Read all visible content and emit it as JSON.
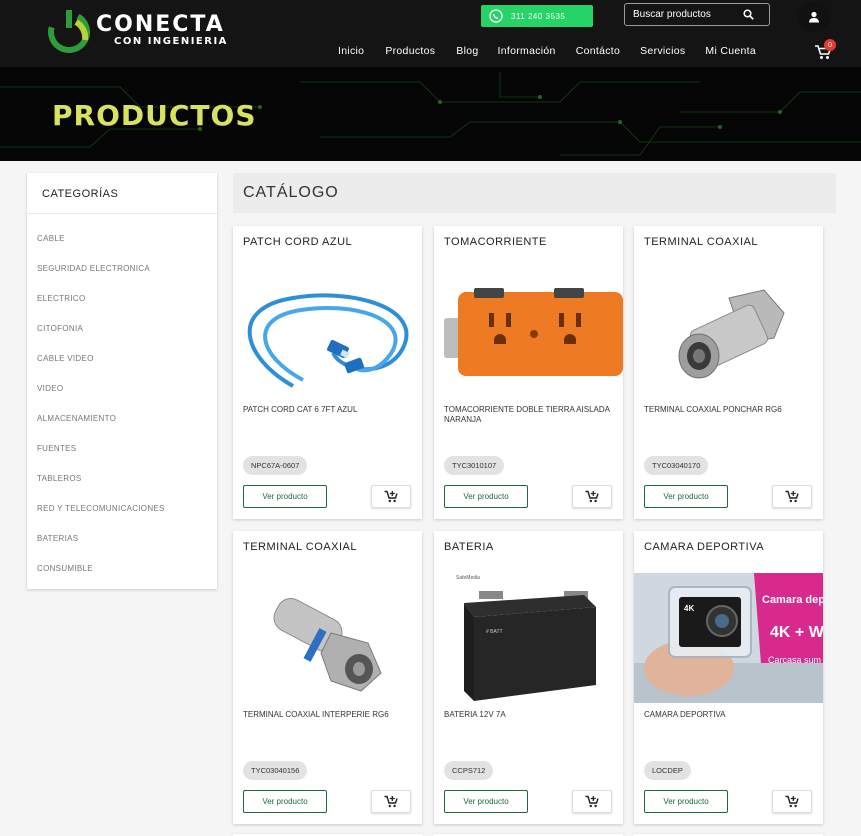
{
  "brand": {
    "logo_word": "CONECTA",
    "logo_sub": "CON INGENIERIA",
    "accent": "#d9e25e",
    "whatsapp_green": "#25d366",
    "button_green": "#1e6b3a"
  },
  "header": {
    "whatsapp_label": "311 240 3535",
    "search_placeholder": "Buscar productos",
    "nav": [
      "Inicio",
      "Productos",
      "Blog",
      "Información",
      "Contácto",
      "Servicios",
      "Mi Cuenta"
    ],
    "cart_count": "0"
  },
  "banner": {
    "title": "PRODUCTOS"
  },
  "sidebar": {
    "title": "CATEGORÍAS",
    "items": [
      "CABLE",
      "SEGURIDAD ELECTRONICA",
      "ELECTRICO",
      "CITOFONIA",
      "CABLE VIDEO",
      "VIDEO",
      "ALMACENAMIENTO",
      "FUENTES",
      "TABLEROS",
      "RED Y TELECOMUNICACIONES",
      "BATERIAS",
      "CONSUMIBLE"
    ]
  },
  "catalog": {
    "title": "CATÁLOGO",
    "view_label": "Ver producto",
    "products": [
      {
        "title": "PATCH CORD AZUL",
        "desc": "PATCH CORD CAT 6 7FT AZUL",
        "sku": "NPC67A-0607",
        "icon": "patch-cord-image"
      },
      {
        "title": "TOMACORRIENTE",
        "desc": "TOMACORRIENTE DOBLE TIERRA AISLADA NARANJA",
        "sku": "TYC3010107",
        "icon": "outlet-image"
      },
      {
        "title": "TERMINAL COAXIAL",
        "desc": "TERMINAL COAXIAL PONCHAR RG6",
        "sku": "TYC03040170",
        "icon": "coax-terminal-image"
      },
      {
        "title": "TERMINAL COAXIAL",
        "desc": "TERMINAL COAXIAL INTERPERIE RG6",
        "sku": "TYC03040156",
        "icon": "coax-terminal-image"
      },
      {
        "title": "BATERIA",
        "desc": "BATERIA 12V 7A",
        "sku": "CCPS712",
        "icon": "battery-image"
      },
      {
        "title": "CAMARA DEPORTIVA",
        "desc": "CAMARA DEPORTIVA",
        "sku": "LOCDEP",
        "icon": "action-camera-image"
      }
    ]
  },
  "image_text": {
    "battery_brand": "SafeMedia",
    "battery_label": "# BATT",
    "camera_promo": [
      "Camara dep",
      "4K + W",
      "Carcasa sum"
    ],
    "camera_badge": "4K"
  }
}
